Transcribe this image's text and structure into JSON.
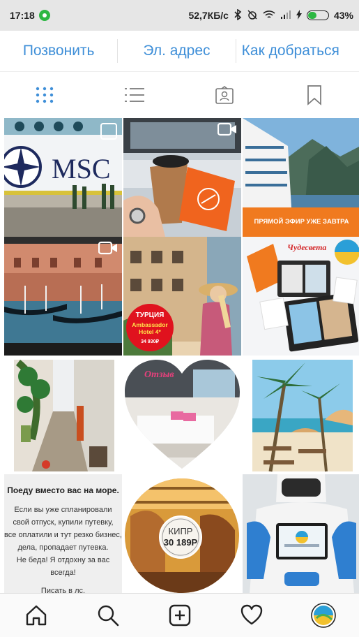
{
  "status": {
    "time": "17:18",
    "speed": "52,7КБ/с",
    "battery": "43%"
  },
  "actions": {
    "call": "Позвонить",
    "email": "Эл. адрес",
    "directions": "Как добраться"
  },
  "tabs": [
    "grid-icon",
    "list-icon",
    "tagged-icon",
    "saved-icon"
  ],
  "posts": {
    "msc_text": "MSC",
    "live_caption": "ПРЯМОЙ ЭФИР УЖЕ ЗАВТРА",
    "turkey_title": "ТУРЦИЯ",
    "turkey_hotel": "Ambassador Hotel 4*",
    "turkey_price": "34 930₽",
    "chudesa": "Чудесвета",
    "otzyv": "Отзыв",
    "kipr": "КИПР",
    "kipr_price": "30 189Р",
    "text_title": "Поеду вместо вас на море.",
    "text_body1": "Если вы уже спланировали",
    "text_body2": "свой отпуск, купили путевку,",
    "text_body3": "все оплатили и тут резко бизнес,",
    "text_body4": "дела, пропадает путевка.",
    "text_body5": "Не беда! Я отдохну за вас всегда!",
    "text_body6": "Писать в лс."
  },
  "nav": [
    "home-icon",
    "search-icon",
    "add-post-icon",
    "activity-icon",
    "profile-avatar"
  ],
  "colors": {
    "accent": "#3f8fd8",
    "whatsapp": "#2cb742",
    "live_orange": "#f07a1f"
  }
}
